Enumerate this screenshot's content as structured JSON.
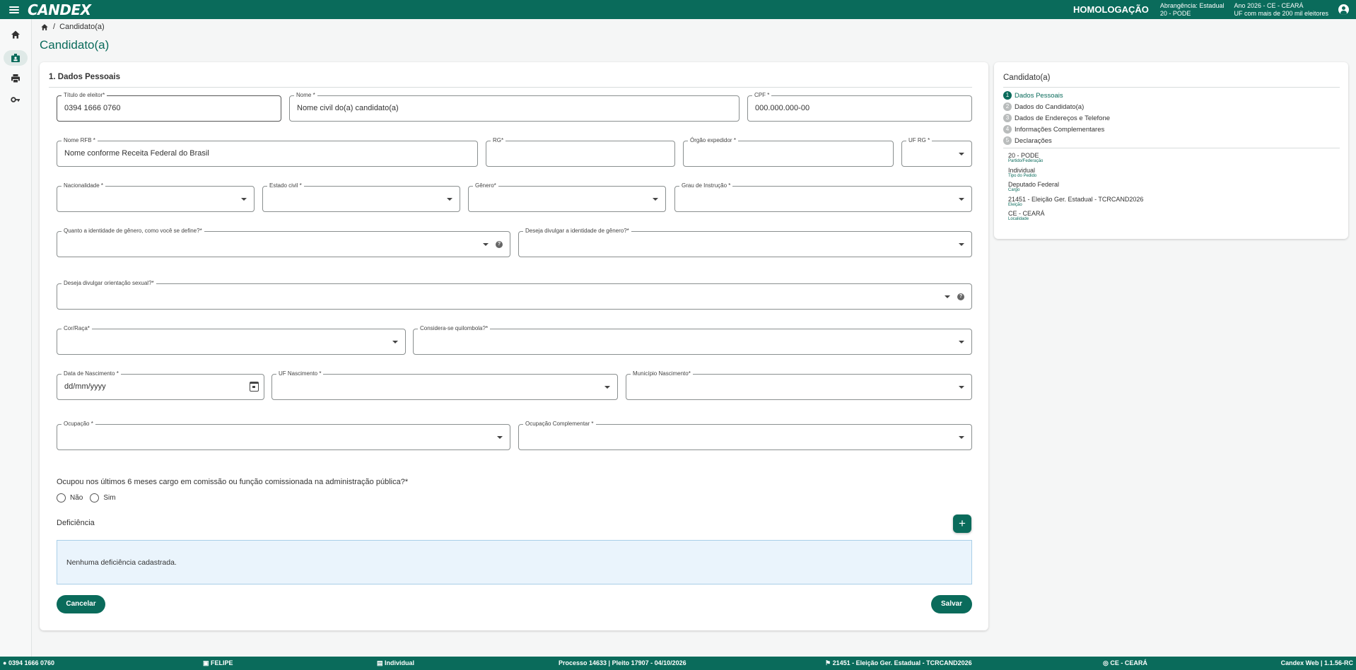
{
  "topbar": {
    "logo": "CANDEX",
    "environment": "HOMOLOGAÇÃO",
    "scope_line1": "Abrangência: Estadual",
    "scope_line2": "20 - PODE",
    "year_line1": "Ano 2026 - CE - CEARÁ",
    "year_line2": "UF com mais de 200 mil eleitores"
  },
  "rail": [
    "home-icon",
    "candidate-icon",
    "print-icon",
    "key-icon"
  ],
  "breadcrumb": {
    "current": "Candidato(a)"
  },
  "page_title": "Candidato(a)",
  "form": {
    "section_title": "1. Dados Pessoais",
    "titulo_eleitor": {
      "label": "Título de eleitor*",
      "value": "0394 1666 0760"
    },
    "nome": {
      "label": "Nome *",
      "placeholder": "Nome civil do(a) candidato(a)"
    },
    "cpf": {
      "label": "CPF *",
      "placeholder": "000.000.000-00"
    },
    "nome_rfb": {
      "label": "Nome RFB *",
      "placeholder": "Nome conforme Receita Federal do Brasil"
    },
    "rg": {
      "label": "RG*"
    },
    "orgao": {
      "label": "Órgão expedidor *"
    },
    "uf_rg": {
      "label": "UF RG *"
    },
    "nacionalidade": {
      "label": "Nacionalidade *"
    },
    "estado_civil": {
      "label": "Estado civil *"
    },
    "genero": {
      "label": "Gênero*"
    },
    "grau_instrucao": {
      "label": "Grau de Instrução *"
    },
    "identidade_genero": {
      "label": "Quanto a identidade de gênero, como você se define?*"
    },
    "divulgar_identidade": {
      "label": "Deseja divulgar a identidade de gênero?*"
    },
    "divulgar_orientacao": {
      "label": "Deseja divulgar orientação sexual?*"
    },
    "cor_raca": {
      "label": "Cor/Raça*"
    },
    "quilombola": {
      "label": "Considera-se quilombola?*"
    },
    "data_nascimento": {
      "label": "Data de Nascimento *",
      "placeholder": "dd/mm/yyyy"
    },
    "uf_nascimento": {
      "label": "UF Nascimento *"
    },
    "municipio_nascimento": {
      "label": "Município Nascimento*"
    },
    "ocupacao": {
      "label": "Ocupação *"
    },
    "ocupacao_complementar": {
      "label": "Ocupação Complementar *"
    },
    "cargo_question": "Ocupou nos últimos 6 meses cargo em comissão ou função comissionada na administração pública?*",
    "option_no": "Não",
    "option_yes": "Sim",
    "deficiencia_title": "Deficiência",
    "deficiencia_empty": "Nenhuma deficiência cadastrada.",
    "cancel": "Cancelar",
    "save": "Salvar"
  },
  "side": {
    "title": "Candidato(a)",
    "steps": [
      {
        "num": "1",
        "label": "Dados Pessoais"
      },
      {
        "num": "2",
        "label": "Dados do Candidato(a)"
      },
      {
        "num": "3",
        "label": "Dados de Endereços e Telefone"
      },
      {
        "num": "4",
        "label": "Informações Complementares"
      },
      {
        "num": "5",
        "label": "Declarações"
      }
    ],
    "info": [
      {
        "value": "20 - PODE",
        "key": "Partido/Federação"
      },
      {
        "value": "Individual",
        "key": "Tipo do Pedido"
      },
      {
        "value": "Deputado Federal",
        "key": "Cargo"
      },
      {
        "value": "21451 - Eleição Ger. Estadual - TCRCAND2026",
        "key": "Eleição"
      },
      {
        "value": "CE - CEARÁ",
        "key": "Localidade"
      }
    ]
  },
  "footer": {
    "titulo": "0394 1666 0760",
    "user": "FELIPE",
    "tipo": "Individual",
    "processo": "Processo 14633 | Pleito 17907 - 04/10/2026",
    "eleicao": "21451 - Eleição Ger. Estadual - TCRCAND2026",
    "local": "CE - CEARÁ",
    "version": "Candex Web | 1.1.56-RC"
  },
  "colors": {
    "brand": "#0a6b5b",
    "info_box": "#eaf4fc"
  }
}
